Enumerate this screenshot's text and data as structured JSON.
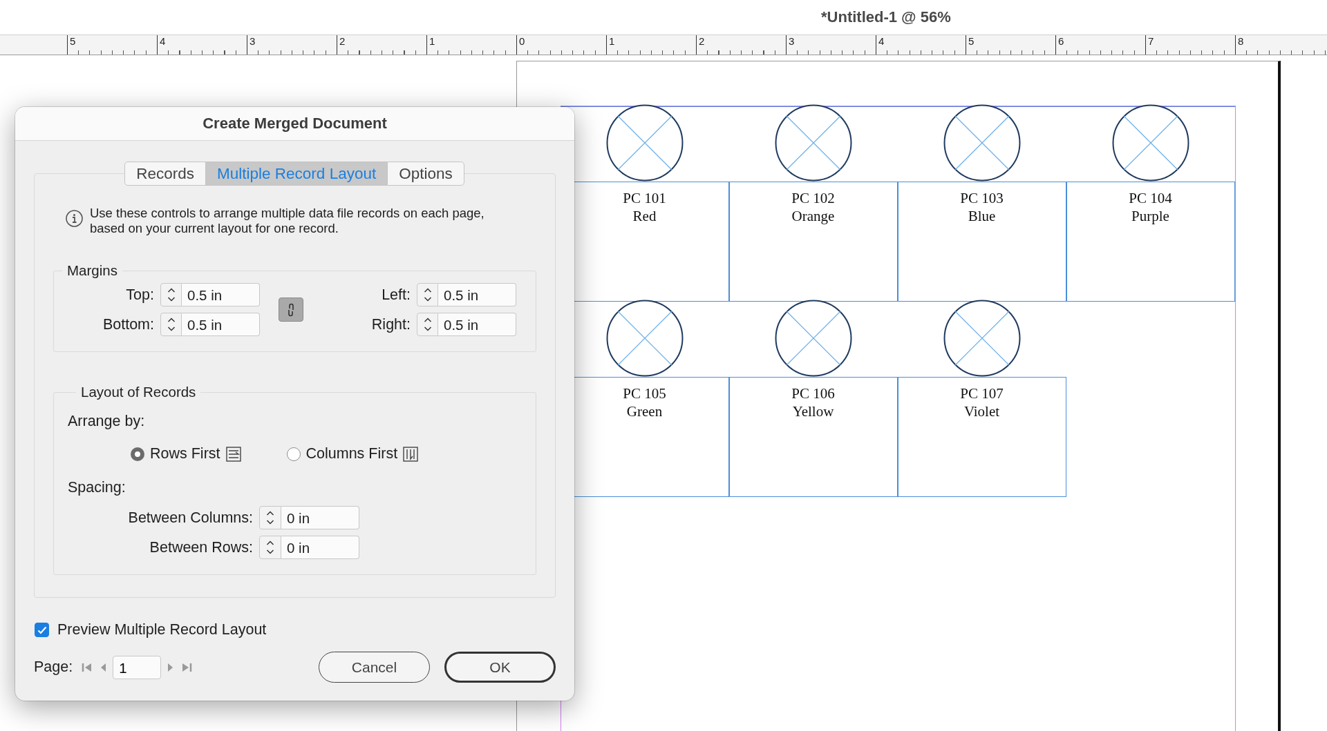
{
  "document_title": "*Untitled-1 @ 56%",
  "ruler": {
    "labels": [
      "5",
      "4",
      "3",
      "2",
      "1",
      "0",
      "1",
      "2",
      "3",
      "4",
      "5",
      "6",
      "7",
      "8"
    ]
  },
  "records": [
    {
      "code": "PC 101",
      "name": "Red"
    },
    {
      "code": "PC 102",
      "name": "Orange"
    },
    {
      "code": "PC 103",
      "name": "Blue"
    },
    {
      "code": "PC 104",
      "name": "Purple"
    },
    {
      "code": "PC 105",
      "name": "Green"
    },
    {
      "code": "PC 106",
      "name": "Yellow"
    },
    {
      "code": "PC 107",
      "name": "Violet"
    }
  ],
  "dialog": {
    "title": "Create Merged Document",
    "tabs": [
      {
        "label": "Records",
        "selected": false
      },
      {
        "label": "Multiple Record Layout",
        "selected": true
      },
      {
        "label": "Options",
        "selected": false
      }
    ],
    "info": "Use these controls to arrange multiple data file records on each page, based on your current layout for one record.",
    "margins": {
      "title": "Margins",
      "linked": true,
      "fields": [
        {
          "label": "Top:",
          "value": "0.5 in"
        },
        {
          "label": "Left:",
          "value": "0.5 in"
        },
        {
          "label": "Bottom:",
          "value": "0.5 in"
        },
        {
          "label": "Right:",
          "value": "0.5 in"
        }
      ]
    },
    "layout": {
      "title": "Layout of Records",
      "arrange_label": "Arrange by:",
      "options": [
        {
          "label": "Rows First",
          "kind": "rows",
          "selected": true
        },
        {
          "label": "Columns First",
          "kind": "columns",
          "selected": false
        }
      ],
      "spacing_label": "Spacing:",
      "fields": [
        {
          "label": "Between Columns:",
          "value": "0 in"
        },
        {
          "label": "Between Rows:",
          "value": "0 in"
        }
      ]
    },
    "preview": {
      "label": "Preview Multiple Record Layout",
      "checked": true
    },
    "page": {
      "label": "Page:",
      "value": "1"
    },
    "buttons": [
      {
        "label": "Cancel",
        "default": false
      },
      {
        "label": "OK",
        "default": true
      }
    ]
  }
}
